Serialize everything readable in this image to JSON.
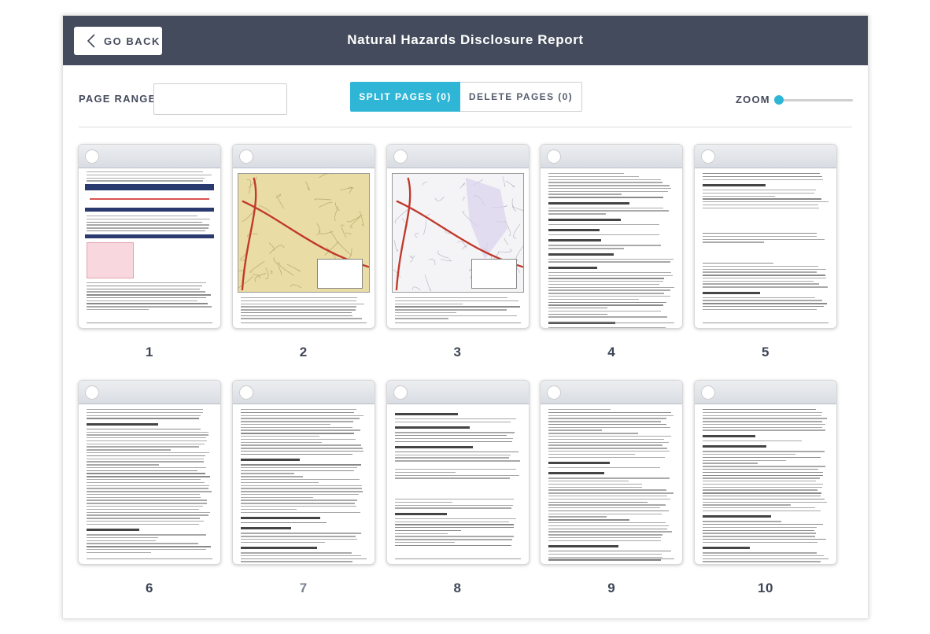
{
  "header": {
    "back_label": "GO BACK",
    "title": "Natural Hazards Disclosure Report"
  },
  "toolbar": {
    "page_range_label": "PAGE RANGE",
    "page_range_value": "",
    "split_label": "SPLIT PAGES (0)",
    "delete_label": "DELETE PAGES (0)",
    "zoom_label": "ZOOM",
    "zoom_level": 0
  },
  "colors": {
    "header_bg": "#444b5c",
    "accent": "#2fb6d6"
  },
  "pages": [
    {
      "number": "1",
      "kind": "invoice"
    },
    {
      "number": "2",
      "kind": "map-yellow"
    },
    {
      "number": "3",
      "kind": "map-white"
    },
    {
      "number": "4",
      "kind": "text"
    },
    {
      "number": "5",
      "kind": "text-sparse"
    },
    {
      "number": "6",
      "kind": "text"
    },
    {
      "number": "7",
      "kind": "text"
    },
    {
      "number": "8",
      "kind": "text-sparse"
    },
    {
      "number": "9",
      "kind": "text"
    },
    {
      "number": "10",
      "kind": "text"
    }
  ]
}
